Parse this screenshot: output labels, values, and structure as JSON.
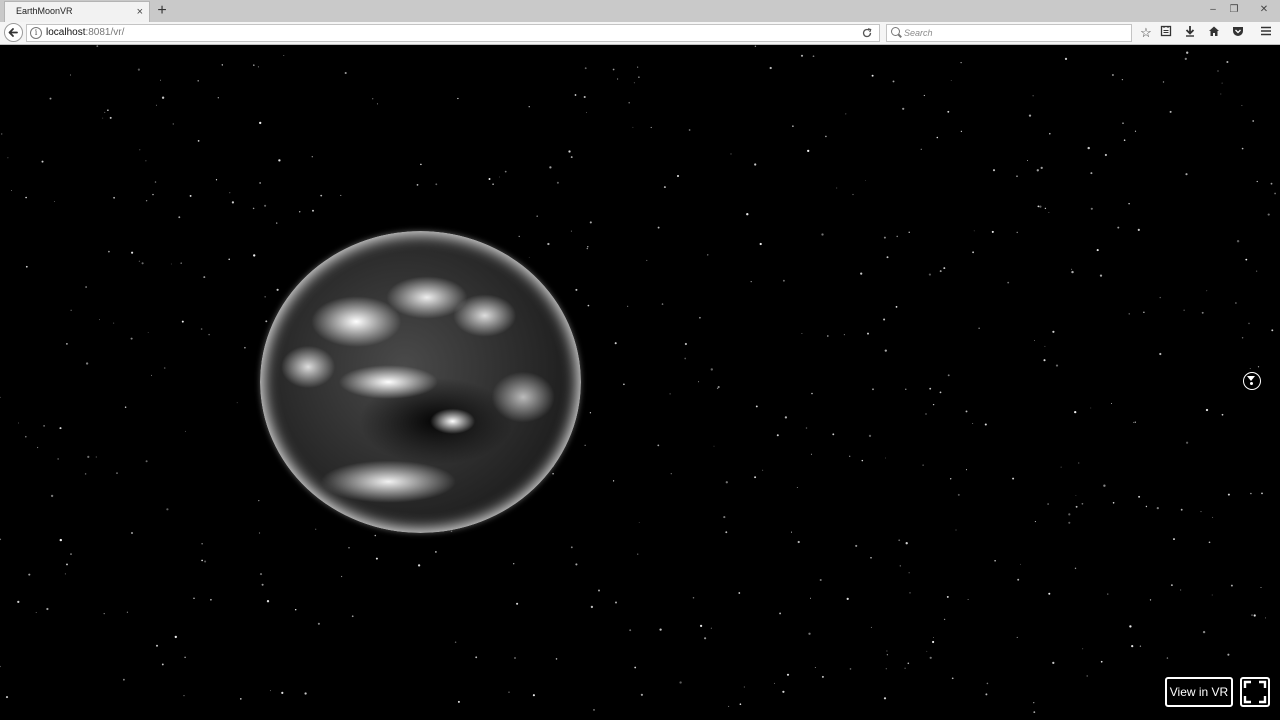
{
  "browser": {
    "tab_title": "EarthMoonVR",
    "tab_close": "×",
    "new_tab": "+",
    "url_host": "localhost",
    "url_rest": ":8081/vr/",
    "search_placeholder": "Search",
    "window_controls": {
      "minimize": "–",
      "restore": "❐",
      "close": "✕"
    },
    "toolbar_icons": [
      "star-icon",
      "reading-list-icon",
      "download-icon",
      "home-icon",
      "pocket-icon",
      "menu-icon"
    ]
  },
  "scene": {
    "background_color": "#000000",
    "vr_button_label": "View in VR"
  }
}
